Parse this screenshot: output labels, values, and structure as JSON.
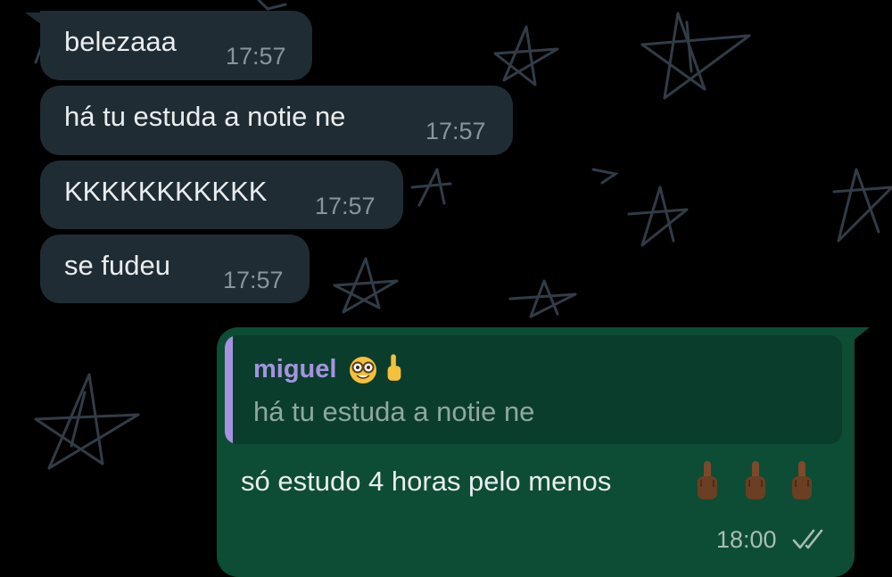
{
  "incoming": [
    {
      "text": "belezaaa",
      "time": "17:57"
    },
    {
      "text": "há tu estuda a notie ne",
      "time": "17:57"
    },
    {
      "text": "KKKKKKKKKKK",
      "time": "17:57"
    },
    {
      "text": "se fudeu",
      "time": "17:57"
    }
  ],
  "outgoing": {
    "quote": {
      "author": "miguel",
      "author_emojis": [
        "nerd-face-icon",
        "pointing-up-hand-icon"
      ],
      "text": "há tu estuda a notie ne"
    },
    "text": "só estudo 4 horas pelo menos",
    "emojis": [
      "middle-finger-icon",
      "middle-finger-icon",
      "middle-finger-icon"
    ],
    "time": "18:00",
    "status": "read-double-check"
  },
  "colors": {
    "incoming_bubble": "#202c33",
    "outgoing_bubble": "#0d4d35",
    "quote_accent": "#a593e0",
    "background": "#000000"
  }
}
